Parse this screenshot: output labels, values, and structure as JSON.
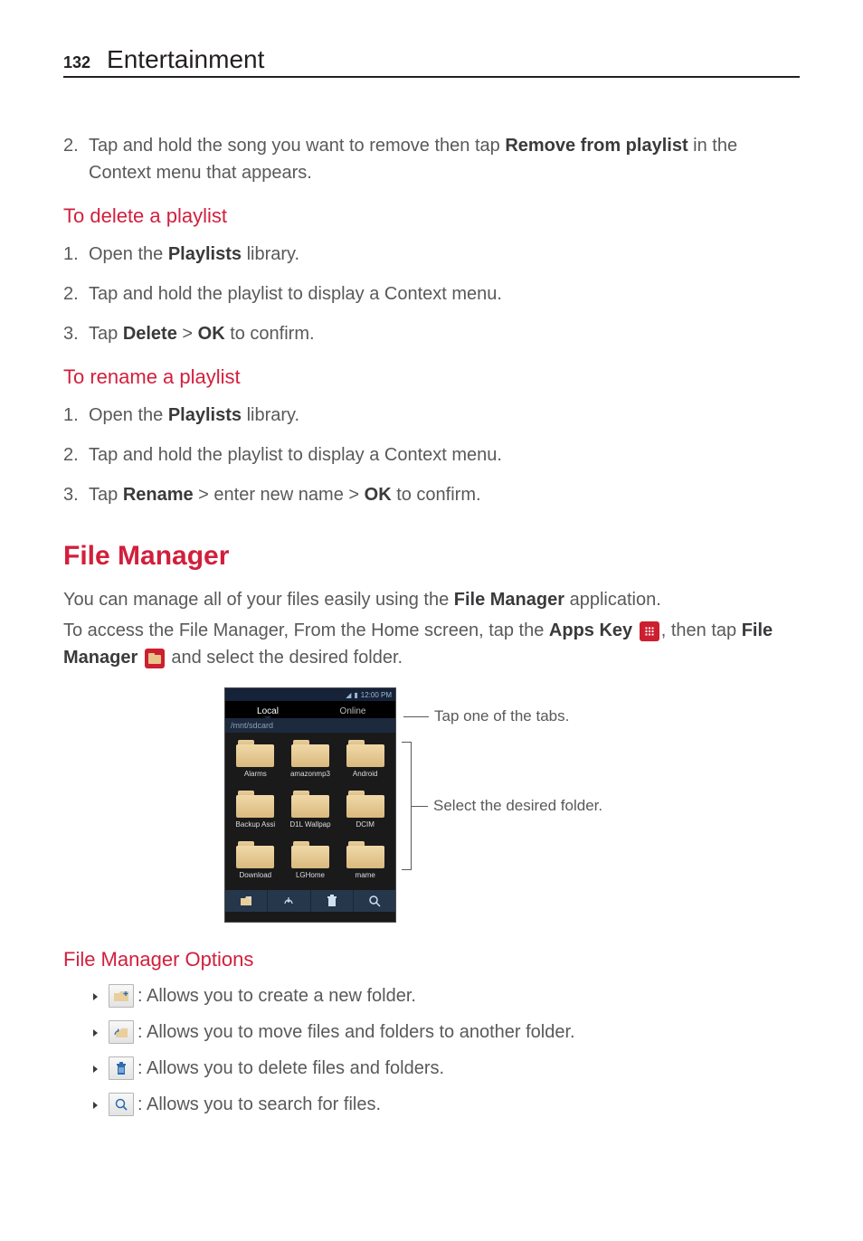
{
  "header": {
    "page_number": "132",
    "chapter": "Entertainment"
  },
  "s1": {
    "step2_num": "2.",
    "step2_a": "Tap and hold the song you want to remove then tap ",
    "step2_bold": "Remove from playlist",
    "step2_b": " in the Context menu that appears."
  },
  "delete": {
    "heading": "To delete a playlist",
    "n1": "1.",
    "n2": "2.",
    "n3": "3.",
    "l1_a": "Open the ",
    "l1_bold": "Playlists",
    "l1_b": " library.",
    "l2": "Tap and hold the playlist to display a Context menu.",
    "l3_a": "Tap ",
    "l3_b1": "Delete",
    "l3_gt": " > ",
    "l3_b2": "OK",
    "l3_b": " to confirm."
  },
  "rename": {
    "heading": "To rename a playlist",
    "n1": "1.",
    "n2": "2.",
    "n3": "3.",
    "l1_a": "Open the ",
    "l1_bold": "Playlists",
    "l1_b": " library.",
    "l2": "Tap and hold the playlist to display a Context menu.",
    "l3_a": "Tap ",
    "l3_b1": "Rename",
    "l3_mid": " > enter new name > ",
    "l3_b2": "OK",
    "l3_b": " to confirm."
  },
  "fm": {
    "title": "File Manager",
    "p1_a": "You can manage all of your files easily using the ",
    "p1_bold": "File Manager",
    "p1_b": " application.",
    "p2_a": "To access the File Manager, From the Home screen, tap the ",
    "p2_b1": "Apps Key",
    "p2_comma": ", then tap ",
    "p2_b2": "File Manager",
    "p2_end": " and select the desired folder."
  },
  "screenshot": {
    "time": "12:00 PM",
    "tab_local": "Local",
    "tab_online": "Online",
    "path": "/mnt/sdcard",
    "folders": [
      "Alarms",
      "amazonmp3",
      "Android",
      "Backup Assi",
      "D1L Wallpap",
      "DCIM",
      "Download",
      "LGHome",
      "mame"
    ],
    "callout_top": "Tap one of the tabs.",
    "callout_mid": "Select the desired folder."
  },
  "options": {
    "heading": "File Manager Options",
    "b1": ": Allows you to create a new folder.",
    "b2": ": Allows you to move files and folders to another folder.",
    "b3": ": Allows you to delete files and folders.",
    "b4": ": Allows you to search for files."
  }
}
